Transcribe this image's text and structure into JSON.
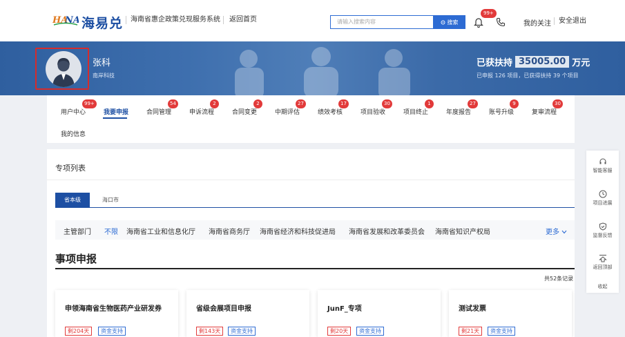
{
  "header": {
    "logo_text": "海易兑",
    "system_name": "海南省惠企政策兑现服务系统",
    "back_home": "返回首页",
    "search_placeholder": "请输入搜索内容",
    "search_button": "搜索",
    "bell_badge": "99+",
    "my_follow": "我的关注",
    "logout": "安全退出"
  },
  "banner": {
    "user_name": "张科",
    "company": "南岸科技",
    "support_prefix": "已获扶持",
    "support_amount": "35005.00",
    "support_unit": "万元",
    "support_sub": "已申报 126 项目，已获得扶持 39 个项目"
  },
  "nav": {
    "tabs": [
      {
        "label": "用户中心",
        "badge": "99+"
      },
      {
        "label": "我要申报",
        "badge": ""
      },
      {
        "label": "合同管理",
        "badge": "54"
      },
      {
        "label": "申诉流程",
        "badge": "2"
      },
      {
        "label": "合同变更",
        "badge": "2"
      },
      {
        "label": "中期评估",
        "badge": "27"
      },
      {
        "label": "绩效考核",
        "badge": "17"
      },
      {
        "label": "项目验收",
        "badge": "30"
      },
      {
        "label": "项目终止",
        "badge": "1"
      },
      {
        "label": "年度报告",
        "badge": "27"
      },
      {
        "label": "账号升级",
        "badge": "9"
      },
      {
        "label": "复审流程",
        "badge": "30"
      }
    ],
    "my_info": "我的信息"
  },
  "main": {
    "section_title": "专项列表",
    "level_tabs": [
      "省本级",
      "海口市"
    ],
    "filter_label": "主管部门",
    "filter_options": [
      "不限",
      "海南省工业和信息化厅",
      "海南省商务厅",
      "海南省经济和科技促进局",
      "海南省发展和改革委员会",
      "海南省知识产权局"
    ],
    "more": "更多",
    "apply_title": "事项申报",
    "total": "共52条记录",
    "cards": [
      {
        "title": "申领海南省生物医药产业研发券",
        "days": "剩204天",
        "type": "资金支持"
      },
      {
        "title": "省级会展项目申报",
        "days": "剩143天",
        "type": "资金支持"
      },
      {
        "title": "JunF_专项",
        "days": "剩20天",
        "type": "资金支持"
      },
      {
        "title": "测试发票",
        "days": "剩21天",
        "type": "资金支持"
      }
    ]
  },
  "side": {
    "items": [
      "智能客服",
      "项目进展",
      "监督反馈",
      "返回顶部"
    ],
    "collapse": "收起"
  },
  "colors": {
    "primary": "#1d4fa3",
    "badge": "#e23a3a",
    "banner": "#3e6fae"
  }
}
